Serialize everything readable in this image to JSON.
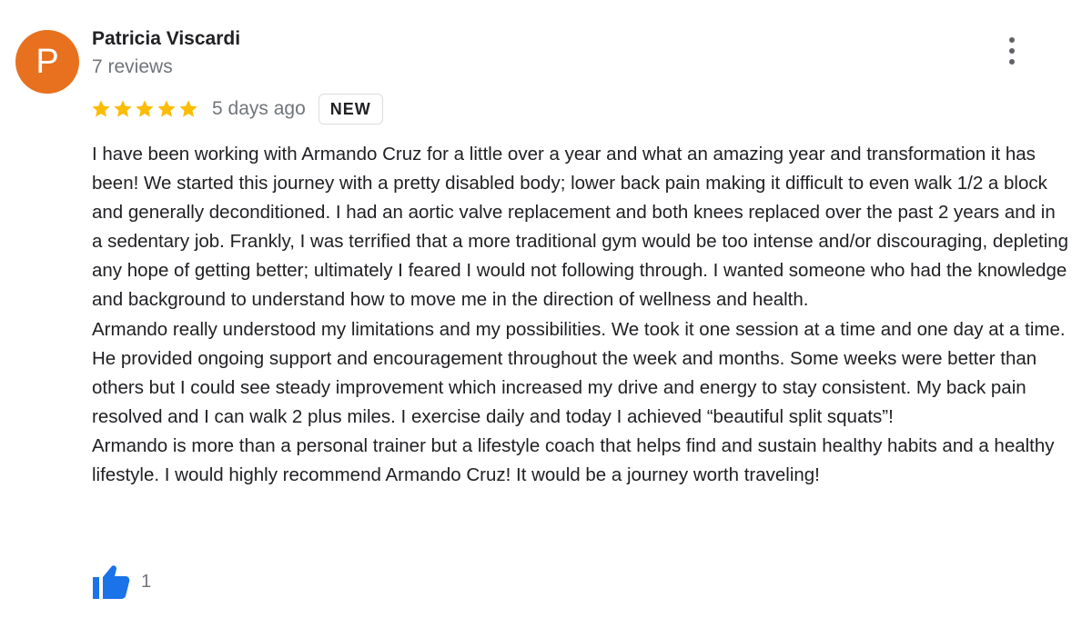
{
  "reviewer": {
    "initial": "P",
    "name": "Patricia Viscardi",
    "review_count": "7 reviews",
    "avatar_color": "#e8711f"
  },
  "menu": {
    "icon": "more-vertical-icon"
  },
  "rating": {
    "stars": 5,
    "max_stars": 5,
    "star_color": "#fbbc04",
    "star_icon": "star-icon",
    "date": "5 days ago",
    "badge": "NEW"
  },
  "review": {
    "paragraphs": [
      "I have been working with Armando Cruz for a little over a year and what an amazing year and transformation it has been! We started this journey with a pretty disabled body; lower back pain making it difficult to even walk 1/2 a block and generally deconditioned. I had an aortic valve replacement and both knees replaced over the past 2 years and in a sedentary job. Frankly, I was terrified that a more traditional gym would be too intense and/or discouraging, depleting any hope of getting better; ultimately I feared I would not following through.  I wanted someone who had the knowledge and background to understand how to move me in the direction of wellness and health.",
      "Armando really understood my limitations and my possibilities. We took it one session at a time and one day at a time. He provided ongoing support and encouragement throughout the week and months. Some weeks were better than others but I could see steady improvement which increased my drive and energy to stay consistent. My back pain resolved and I can walk 2 plus miles. I exercise daily and today I achieved “beautiful split squats”!",
      "Armando is more than a personal trainer but a lifestyle coach that helps find and sustain healthy habits and a healthy lifestyle. I would highly recommend Armando Cruz! It would be a journey worth traveling!"
    ]
  },
  "likes": {
    "icon": "thumbs-up-icon",
    "count": "1",
    "icon_color": "#1a73e8"
  }
}
